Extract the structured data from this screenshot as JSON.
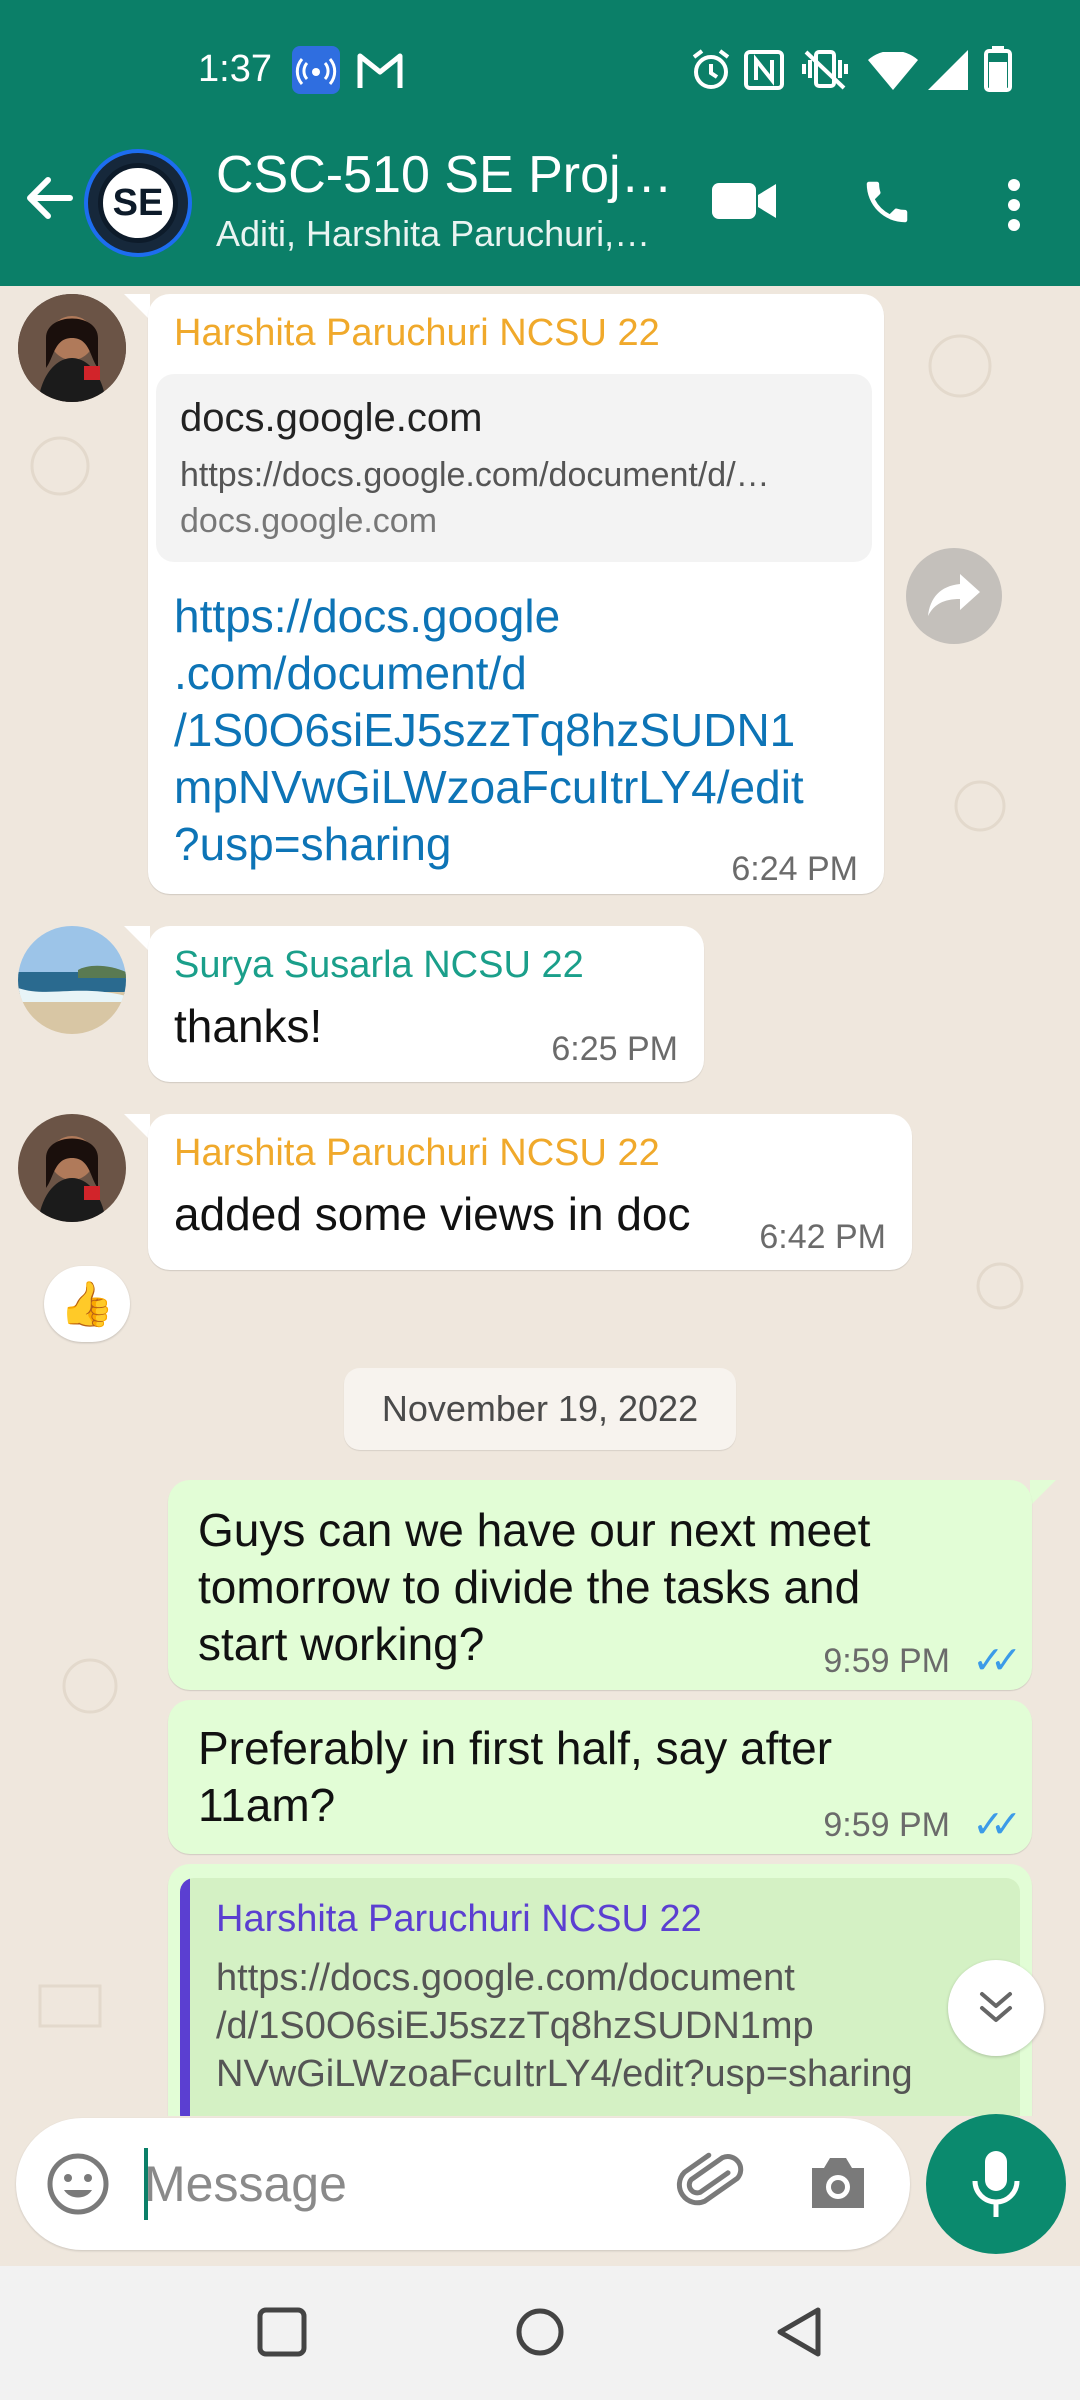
{
  "status_bar": {
    "time": "1:37",
    "icons": [
      "hotspot-icon",
      "gmail-icon",
      "alarm-icon",
      "nfc-icon",
      "vibrate-icon",
      "wifi-icon",
      "signal-icon",
      "battery-icon"
    ]
  },
  "header": {
    "title": "CSC-510 SE Proj…",
    "subtitle": "Aditi, Harshita Paruchuri,…",
    "avatar_text": "SE"
  },
  "colors": {
    "header_bg": "#0b7f68",
    "chat_bg": "#efe7dd",
    "outgoing_bubble": "#e2fdd6",
    "sender_harshita": "#f0a92b",
    "sender_surya": "#1a9f8a",
    "link": "#0d74b6",
    "quote_bar": "#5b3fd1"
  },
  "messages": [
    {
      "sender": "Harshita Paruchuri NCSU 22",
      "preview_title": "docs.google.com",
      "preview_url": "https://docs.google.com/document/d/…",
      "preview_domain": "docs.google.com",
      "link_lines": [
        "https://docs.google",
        ".com/document/d",
        "/1S0O6siEJ5szzTq8hzSUDN1",
        "mpNVwGiLWzoaFcuItrLY4/edit",
        "?usp=sharing"
      ],
      "time": "6:24 PM"
    },
    {
      "sender": "Surya Susarla NCSU 22",
      "text": "thanks!",
      "time": "6:25 PM"
    },
    {
      "sender": "Harshita Paruchuri NCSU 22",
      "text": "added some views in doc",
      "time": "6:42 PM",
      "reaction": "👍"
    }
  ],
  "date_divider": "November 19, 2022",
  "outgoing": [
    {
      "text_lines": [
        "Guys can we have our next meet",
        "tomorrow to divide the tasks and",
        "start working?"
      ],
      "time": "9:59 PM",
      "ticks": "✓✓"
    },
    {
      "text_lines": [
        "Preferably in first half, say after",
        "11am?"
      ],
      "time": "9:59 PM",
      "ticks": "✓✓"
    },
    {
      "quote_sender": "Harshita Paruchuri NCSU 22",
      "quote_lines": [
        "https://docs.google.com/document",
        "/d/1S0O6siEJ5szzTq8hzSUDN1mp",
        "NVwGiLWzoaFcuItrLY4/edit?usp=sharing"
      ]
    }
  ],
  "composer": {
    "placeholder": "Message"
  }
}
